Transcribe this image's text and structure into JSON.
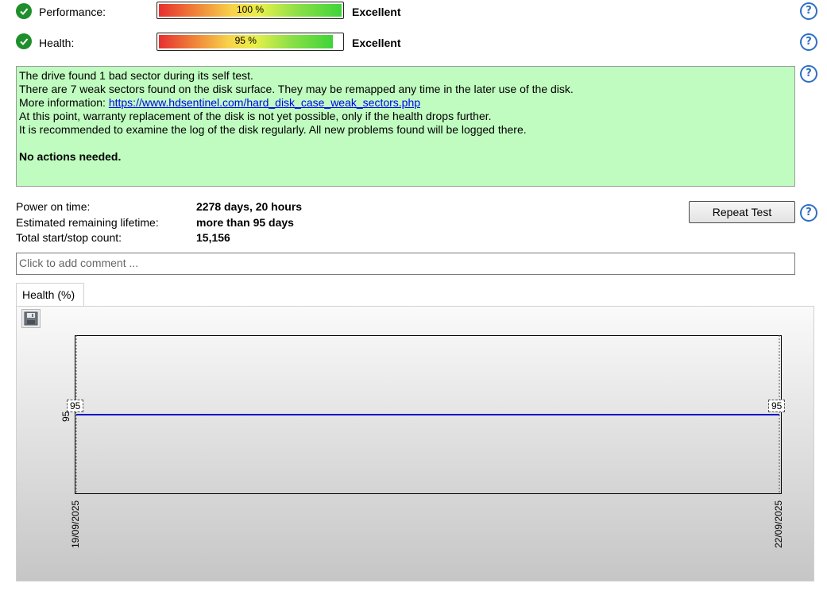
{
  "performance": {
    "label": "Performance:",
    "percent_text": "100 %",
    "percent": 100,
    "status": "Excellent"
  },
  "health": {
    "label": "Health:",
    "percent_text": "95 %",
    "percent": 95,
    "status": "Excellent"
  },
  "message": {
    "line1": "The drive found 1 bad sector during its self test.",
    "line2": "There are 7 weak sectors found on the disk surface. They may be remapped any time in the later use of the disk.",
    "line3_prefix": "More information: ",
    "link": "https://www.hdsentinel.com/hard_disk_case_weak_sectors.php",
    "line4": "At this point, warranty replacement of the disk is not yet possible, only if the health drops further.",
    "line5": "It is recommended to examine the log of the disk regularly. All new problems found will be logged there.",
    "action": "No actions needed."
  },
  "info": {
    "power_on_label": "Power on time:",
    "power_on_value": "2278 days, 20 hours",
    "lifetime_label": "Estimated remaining lifetime:",
    "lifetime_value": "more than 95 days",
    "startstop_label": "Total start/stop count:",
    "startstop_value": "15,156"
  },
  "repeat_test_label": "Repeat Test",
  "help_icon_glyph": "?",
  "comment_placeholder": "Click to add comment ...",
  "chart_tab_label": "Health (%)",
  "chart_data": {
    "type": "line",
    "x": [
      "19/09/2025",
      "22/09/2025"
    ],
    "series": [
      {
        "values": [
          95,
          95
        ],
        "color": "#0000c8"
      }
    ],
    "point_labels": [
      "95",
      "95"
    ],
    "y_tick_labels": [
      "95"
    ],
    "grid": false
  }
}
